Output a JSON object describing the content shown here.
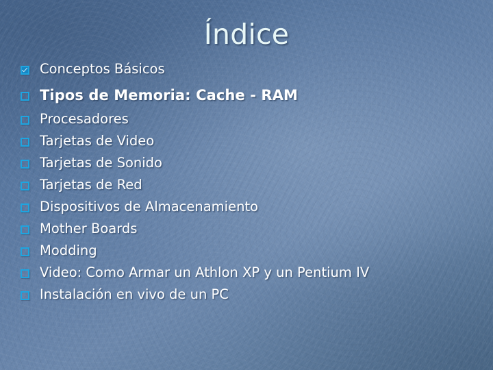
{
  "slide": {
    "title": "Índice",
    "title_color": "#e8f7f7",
    "background_color": "#5a76a0",
    "bullet_color": "#1ea5e0",
    "text_color": "#ffffff",
    "items": [
      {
        "label": "Conceptos Básicos",
        "marker": "checked-box",
        "bold": false
      },
      {
        "label": "Tipos de Memoria: Cache - RAM",
        "marker": "empty-box",
        "bold": true
      },
      {
        "label": "Procesadores",
        "marker": "empty-box",
        "bold": false
      },
      {
        "label": "Tarjetas de Video",
        "marker": "empty-box",
        "bold": false
      },
      {
        "label": "Tarjetas de Sonido",
        "marker": "empty-box",
        "bold": false
      },
      {
        "label": "Tarjetas de Red",
        "marker": "empty-box",
        "bold": false
      },
      {
        "label": "Dispositivos de Almacenamiento",
        "marker": "empty-box",
        "bold": false
      },
      {
        "label": "Mother Boards",
        "marker": "empty-box",
        "bold": false
      },
      {
        "label": "Modding",
        "marker": "empty-box",
        "bold": false
      },
      {
        "label": "Video: Como Armar un Athlon XP y un Pentium IV",
        "marker": "empty-box",
        "bold": false
      },
      {
        "label": "Instalación en vivo de un PC",
        "marker": "empty-box",
        "bold": false
      }
    ]
  }
}
